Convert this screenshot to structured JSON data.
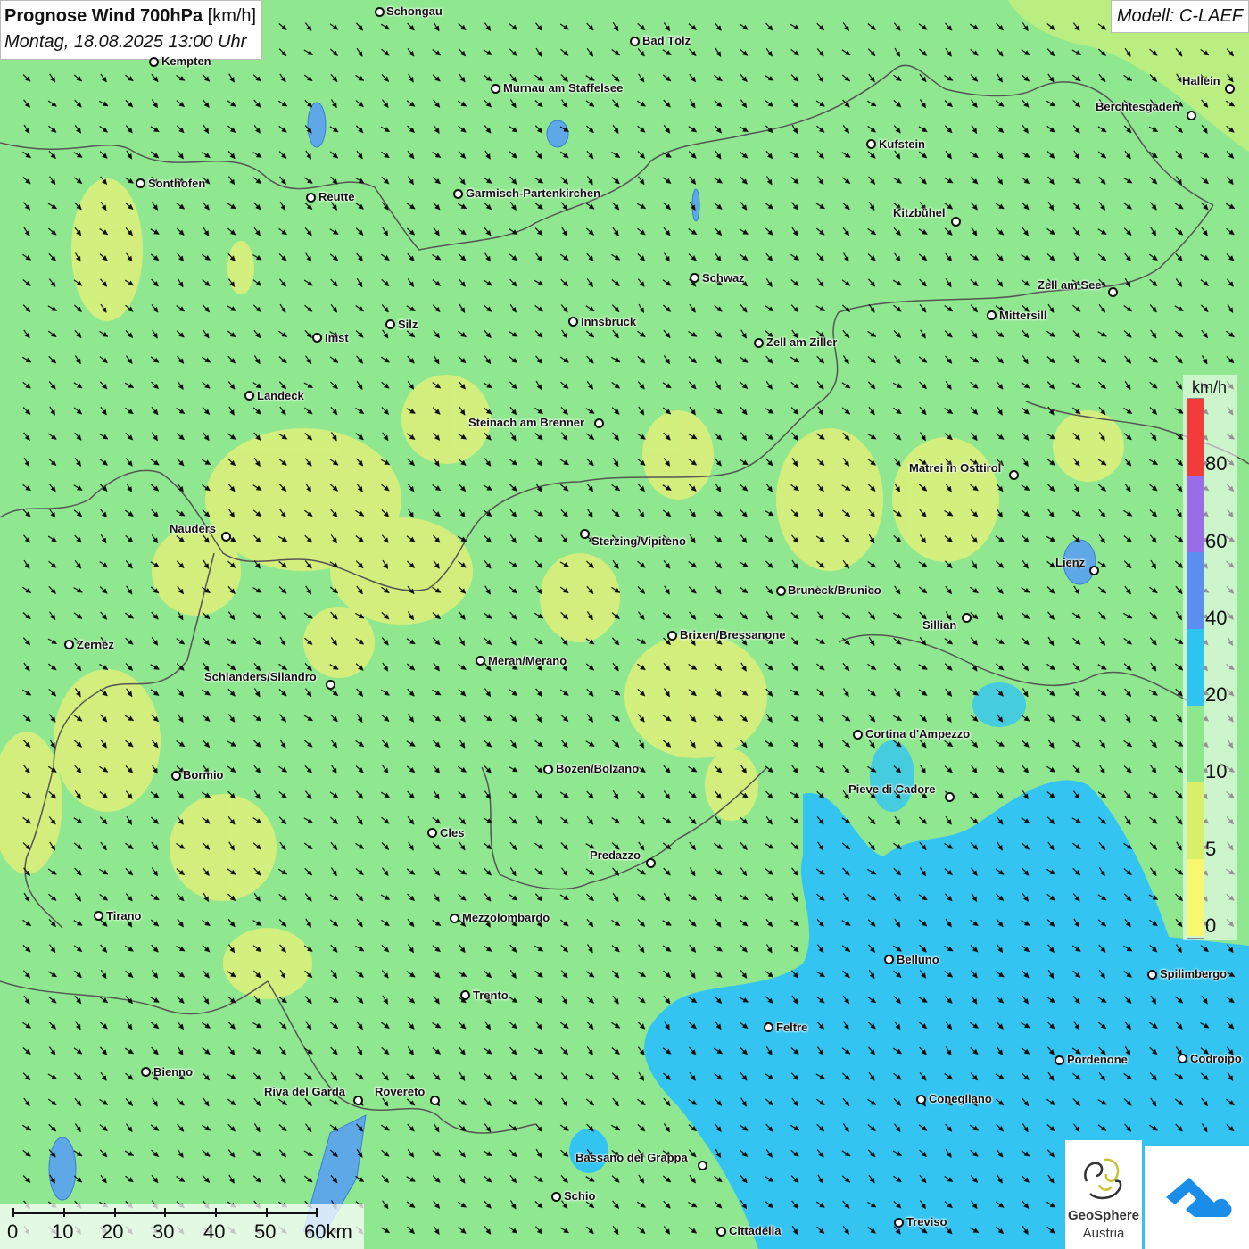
{
  "header": {
    "title_main": "Prognose Wind 700hPa",
    "title_unit": "[km/h]",
    "subtitle": "Montag, 18.08.2025 13:00 Uhr",
    "model": "Modell: C-LAEF"
  },
  "legend": {
    "unit": "km/h",
    "labels": [
      "80",
      "60",
      "40",
      "20",
      "10",
      "5",
      "0"
    ],
    "colors": [
      "#f23b3b",
      "#9a6ce8",
      "#5c8ef0",
      "#2ec4f0",
      "#8de88d",
      "#d8f068",
      "#f8f870"
    ]
  },
  "scale_bar": {
    "labels": [
      "0",
      "10",
      "20",
      "30",
      "40",
      "50",
      "60km"
    ]
  },
  "logos": {
    "geosphere_line1": "GeoSphere",
    "geosphere_line2": "Austria",
    "geosphere_icon": "geosphere-swirl-icon",
    "cloud_icon": "cloud-arrow-icon"
  },
  "colors": {
    "background_green": "#8fe88f",
    "low_wind_yellow": "#dff07a",
    "blue_zone": "#33c4f2",
    "border_line": "#555555",
    "water": "#5fa8e8"
  },
  "wind": {
    "arrow_color": "#111111",
    "predominant_direction": "northwest to southeast"
  },
  "cities": [
    {
      "name": "Schongau"
    },
    {
      "name": "Bad Tölz"
    },
    {
      "name": "Kempten"
    },
    {
      "name": "Murnau am Staffelsee"
    },
    {
      "name": "Hallein"
    },
    {
      "name": "Berchtesgaden"
    },
    {
      "name": "Kufstein"
    },
    {
      "name": "Sonthofen"
    },
    {
      "name": "Reutte"
    },
    {
      "name": "Garmisch-Partenkirchen"
    },
    {
      "name": "Kitzbühel"
    },
    {
      "name": "Schwaz"
    },
    {
      "name": "Zell am See"
    },
    {
      "name": "Mittersill"
    },
    {
      "name": "Innsbruck"
    },
    {
      "name": "Silz"
    },
    {
      "name": "Imst"
    },
    {
      "name": "Zell am Ziller"
    },
    {
      "name": "Landeck"
    },
    {
      "name": "Steinach am Brenner"
    },
    {
      "name": "Matrei in Osttirol"
    },
    {
      "name": "Nauders"
    },
    {
      "name": "Sterzing/Vipiteno"
    },
    {
      "name": "Lienz"
    },
    {
      "name": "Bruneck/Brunico"
    },
    {
      "name": "Sillian"
    },
    {
      "name": "Zernez"
    },
    {
      "name": "Brixen/Bressanone"
    },
    {
      "name": "Meran/Merano"
    },
    {
      "name": "Schlanders/Silandro"
    },
    {
      "name": "Cortina d'Ampezzo"
    },
    {
      "name": "Bozen/Bolzano"
    },
    {
      "name": "Bormio"
    },
    {
      "name": "Pieve di Cadore"
    },
    {
      "name": "Cles"
    },
    {
      "name": "Predazzo"
    },
    {
      "name": "Tirano"
    },
    {
      "name": "Mezzolombardo"
    },
    {
      "name": "Belluno"
    },
    {
      "name": "Spilimbergo"
    },
    {
      "name": "Trento"
    },
    {
      "name": "Feltre"
    },
    {
      "name": "Bienno"
    },
    {
      "name": "Pordenone"
    },
    {
      "name": "Codroipo"
    },
    {
      "name": "Riva del Garda"
    },
    {
      "name": "Rovereto"
    },
    {
      "name": "Conegliano"
    },
    {
      "name": "Bassano del Grappa"
    },
    {
      "name": "Schio"
    },
    {
      "name": "Treviso"
    },
    {
      "name": "Cittadella"
    }
  ]
}
